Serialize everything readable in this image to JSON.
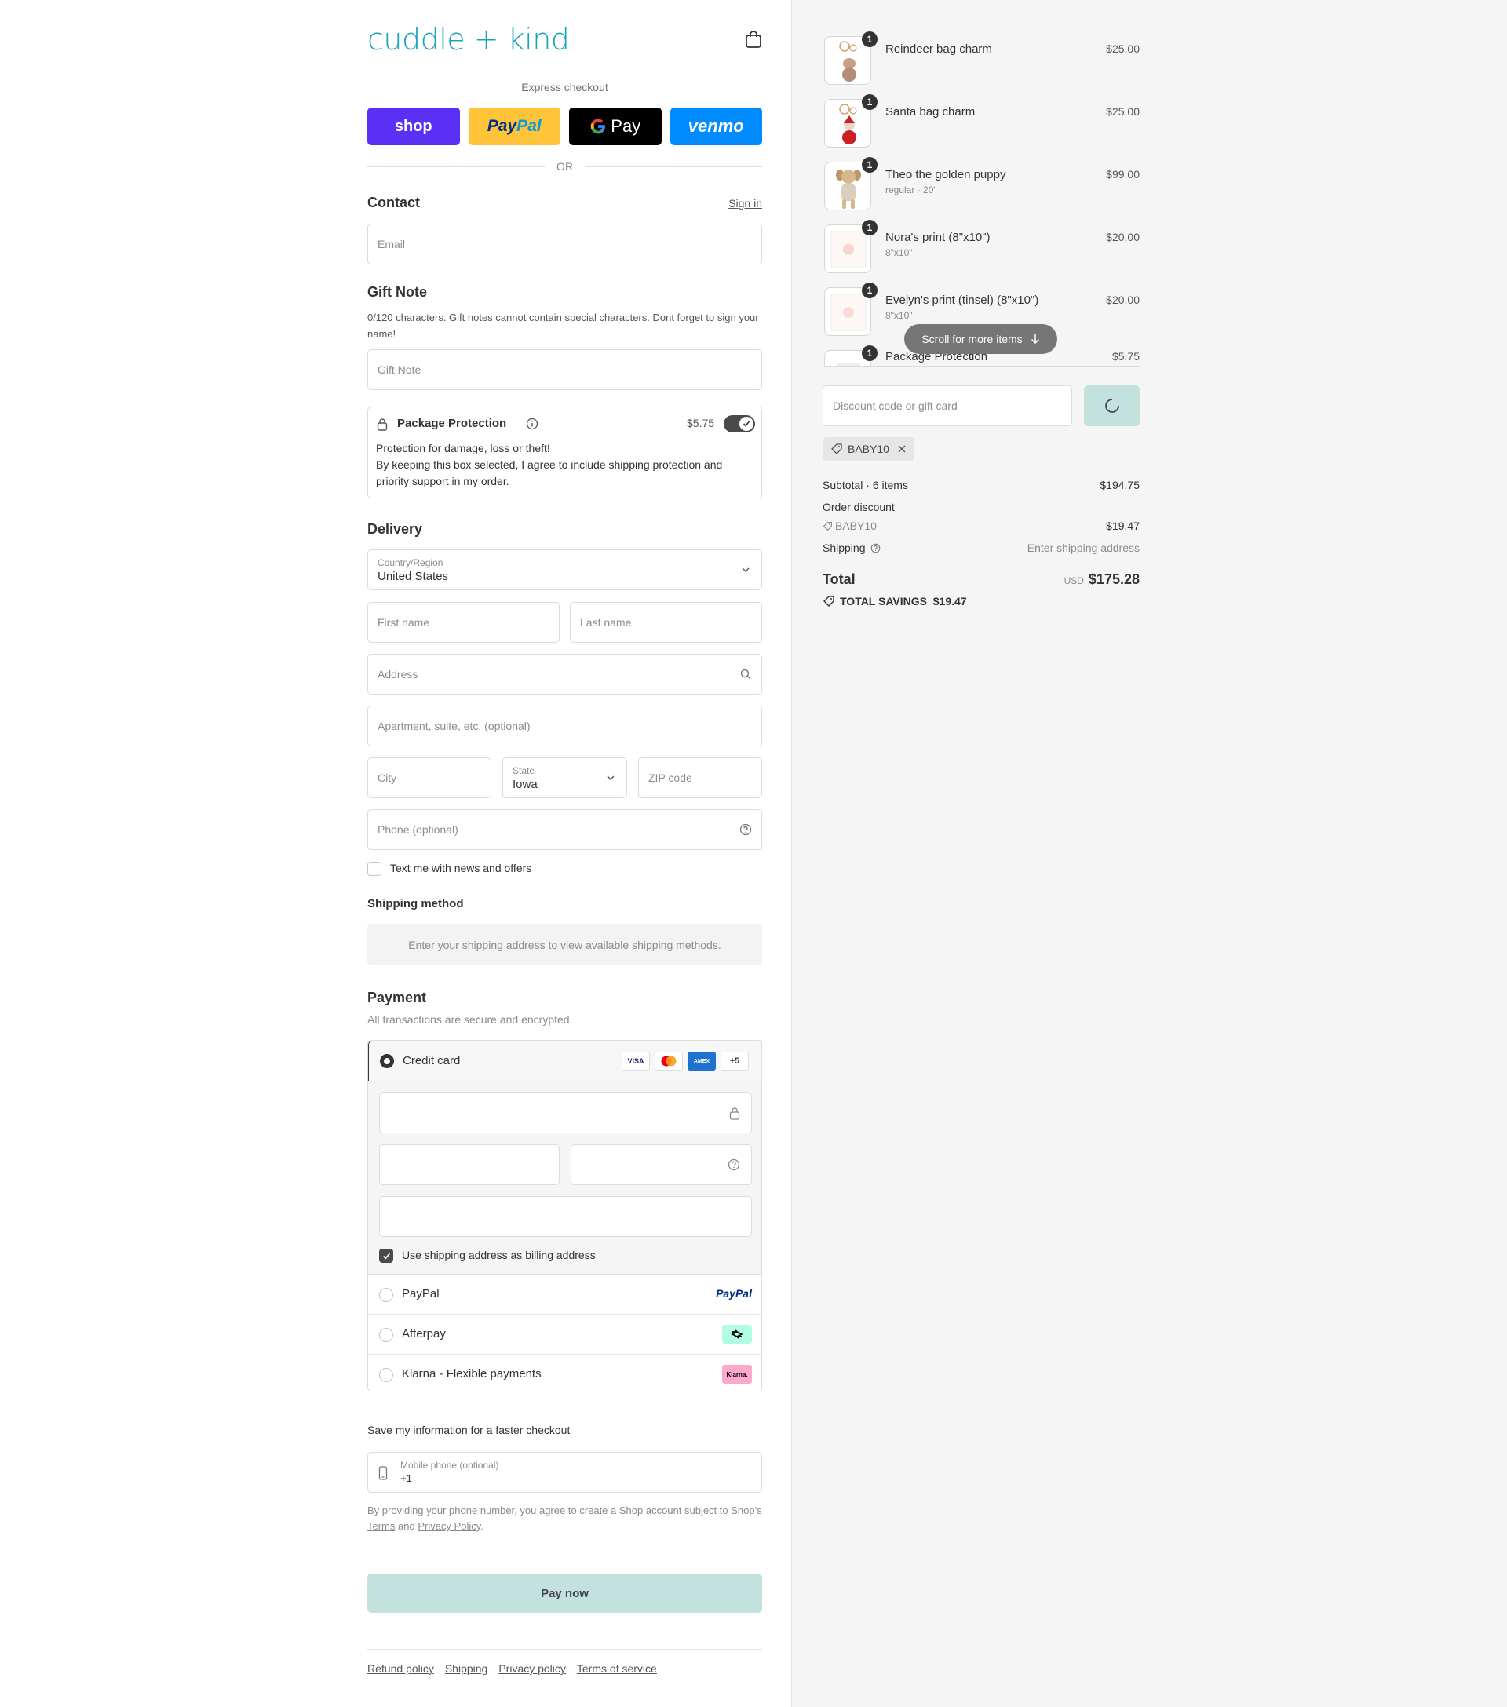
{
  "brand": {
    "logo_text": "cuddle + kind",
    "accent_color": "#1aa3b6"
  },
  "express": {
    "label": "Express checkout",
    "buttons": {
      "shop": "shop",
      "paypal_a": "Pay",
      "paypal_b": "Pal",
      "gpay": "Pay",
      "venmo": "venmo"
    },
    "or": "OR"
  },
  "contact": {
    "title": "Contact",
    "sign_in": "Sign in",
    "email_placeholder": "Email"
  },
  "gift_note": {
    "title": "Gift Note",
    "help": "0/120 characters. Gift notes cannot contain special characters. Dont forget to sign your name!",
    "placeholder": "Gift Note"
  },
  "package_protection": {
    "title": "Package Protection",
    "price": "$5.75",
    "desc": "Protection for damage, loss or theft!\nBy keeping this box selected, I agree to include shipping protection and priority support in my order."
  },
  "delivery": {
    "title": "Delivery",
    "country_label": "Country/Region",
    "country_value": "United States",
    "first_name": "First name",
    "last_name": "Last name",
    "address": "Address",
    "apartment": "Apartment, suite, etc. (optional)",
    "city": "City",
    "state_label": "State",
    "state_value": "Iowa",
    "zip": "ZIP code",
    "phone": "Phone (optional)",
    "text_me": "Text me with news and offers"
  },
  "shipping_method": {
    "title": "Shipping method",
    "message": "Enter your shipping address to view available shipping methods."
  },
  "payment": {
    "title": "Payment",
    "subtitle": "All transactions are secure and encrypted.",
    "credit_card": "Credit card",
    "card_logos": {
      "visa": "VISA",
      "amex": "AMEX",
      "more": "+5"
    },
    "billing_same": "Use shipping address as billing address",
    "paypal": "PayPal",
    "paypal_logo": "PayPal",
    "afterpay": "Afterpay",
    "klarna": "Klarna - Flexible payments",
    "klarna_logo": "Klarna."
  },
  "save_info": {
    "title": "Save my information for a faster checkout",
    "mobile_label": "Mobile phone (optional)",
    "mobile_value": "+1",
    "legal_a": "By providing your phone number, you agree to create a Shop account subject to Shop's ",
    "terms": "Terms",
    "and": " and ",
    "privacy": "Privacy Policy",
    "period": "."
  },
  "pay_now": "Pay now",
  "footer": [
    "Refund policy",
    "Shipping",
    "Privacy policy",
    "Terms of service"
  ],
  "cart": {
    "items": [
      {
        "qty": "1",
        "name": "Reindeer bag charm",
        "variant": "",
        "price": "$25.00",
        "icon": "reindeer-charm"
      },
      {
        "qty": "1",
        "name": "Santa bag charm",
        "variant": "",
        "price": "$25.00",
        "icon": "santa-charm"
      },
      {
        "qty": "1",
        "name": "Theo the golden puppy",
        "variant": "regular - 20\"",
        "price": "$99.00",
        "icon": "puppy-plush"
      },
      {
        "qty": "1",
        "name": "Nora's print (8\"x10\")",
        "variant": "8\"x10\"",
        "price": "$20.00",
        "icon": "print"
      },
      {
        "qty": "1",
        "name": "Evelyn's print (tinsel) (8\"x10\")",
        "variant": "8\"x10\"",
        "price": "$20.00",
        "icon": "print"
      },
      {
        "qty": "1",
        "name": "Package Protection",
        "variant": "",
        "price": "$5.75",
        "icon": "package"
      }
    ],
    "scroll_hint": "Scroll for more items",
    "discount_placeholder": "Discount code or gift card",
    "applied_code": "BABY10",
    "subtotal_label": "Subtotal · 6 items",
    "subtotal": "$194.75",
    "order_discount_label": "Order discount",
    "discount_code": "BABY10",
    "discount_amount": "– $19.47",
    "shipping_label": "Shipping",
    "shipping_value": "Enter shipping address",
    "total_label": "Total",
    "currency": "USD",
    "total": "$175.28",
    "savings_label": "TOTAL SAVINGS",
    "savings": "$19.47"
  }
}
